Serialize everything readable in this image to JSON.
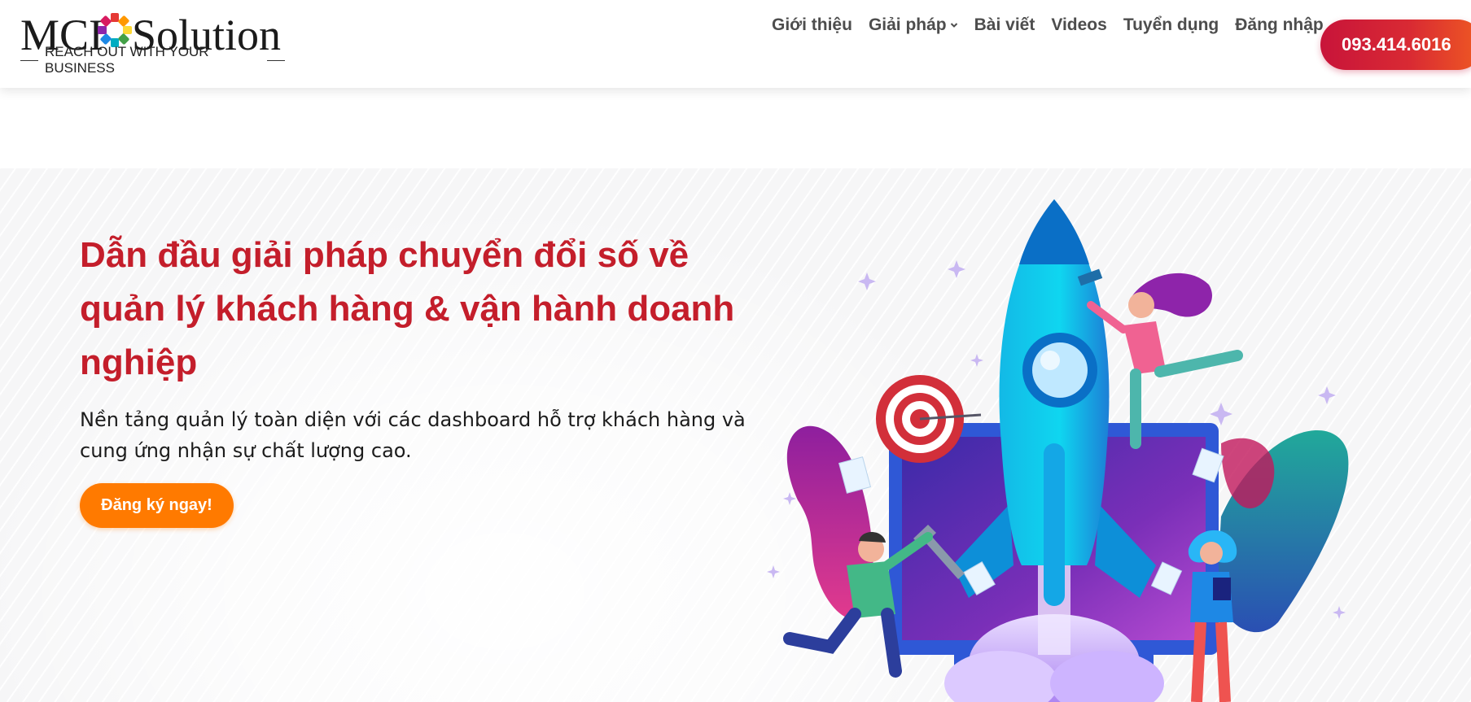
{
  "brand": {
    "word_left": "MCI",
    "word_right": "Solution",
    "tagline": "REACH OUT WITH YOUR BUSINESS"
  },
  "nav": {
    "items": [
      {
        "label": "Giới thiệu"
      },
      {
        "label": "Giải pháp"
      },
      {
        "label": "Bài viết"
      },
      {
        "label": "Videos"
      },
      {
        "label": "Tuyển dụng"
      },
      {
        "label": "Đăng nhập"
      }
    ],
    "phone": "093.414.6016"
  },
  "hero": {
    "title": "Dẫn đầu giải pháp chuyển đổi số về quản lý khách hàng & vận hành doanh nghiệp",
    "subtitle": "Nền tảng quản lý toàn diện với các dashboard hỗ trợ khách hàng và cung ứng nhận sự chất lượng cao.",
    "cta": "Đăng ký ngay!"
  },
  "colors": {
    "title_red": "#c41e2b",
    "cta_orange": "#ff7a00",
    "phone_gradient_start": "#c8143a",
    "phone_gradient_end": "#ef5a22",
    "nav_text": "#4d4d4d"
  },
  "icons": {
    "logo_mark": "puzzle-ring-icon",
    "dropdown": "chevron-down-icon",
    "illustration": "rocket-launch-illustration"
  }
}
